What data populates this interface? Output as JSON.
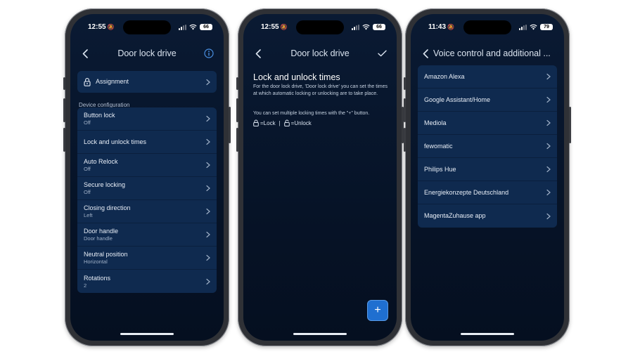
{
  "phone1": {
    "status": {
      "time": "12:55",
      "battery": "66"
    },
    "title": "Door lock drive",
    "assignment_label": "Assignment",
    "section_label": "Device configuration",
    "items": [
      {
        "label": "Button lock",
        "value": "Off"
      },
      {
        "label": "Lock and unlock times",
        "value": ""
      },
      {
        "label": "Auto Relock",
        "value": "Off"
      },
      {
        "label": "Secure locking",
        "value": "Off"
      },
      {
        "label": "Closing direction",
        "value": "Left"
      },
      {
        "label": "Door handle",
        "value": "Door handle"
      },
      {
        "label": "Neutral position",
        "value": "Horizontal"
      },
      {
        "label": "Rotations",
        "value": "2"
      }
    ]
  },
  "phone2": {
    "status": {
      "time": "12:55",
      "battery": "66"
    },
    "title": "Door lock drive",
    "heading": "Lock and unlock times",
    "description": "For the door lock drive, 'Door lock drive' you can set the times at which automatic locking or unlocking are to take place.",
    "hint": "You can set multiple locking times with the \"+\" button.",
    "legend_lock": "=Lock",
    "legend_sep": "|",
    "legend_unlock": "=Unlock",
    "add_label": "+"
  },
  "phone3": {
    "status": {
      "time": "11:43",
      "battery": "79"
    },
    "title": "Voice control and additional ...",
    "items": [
      "Amazon Alexa",
      "Google Assistant/Home",
      "Mediola",
      "fewomatic",
      "Philips Hue",
      "Energiekonzepte Deutschland",
      "MagentaZuhause app"
    ]
  },
  "colors": {
    "screen_bg": "#061327",
    "card_bg": "#0f2a4f",
    "accent": "#1f6fd0",
    "info_icon": "#4a90e2"
  }
}
